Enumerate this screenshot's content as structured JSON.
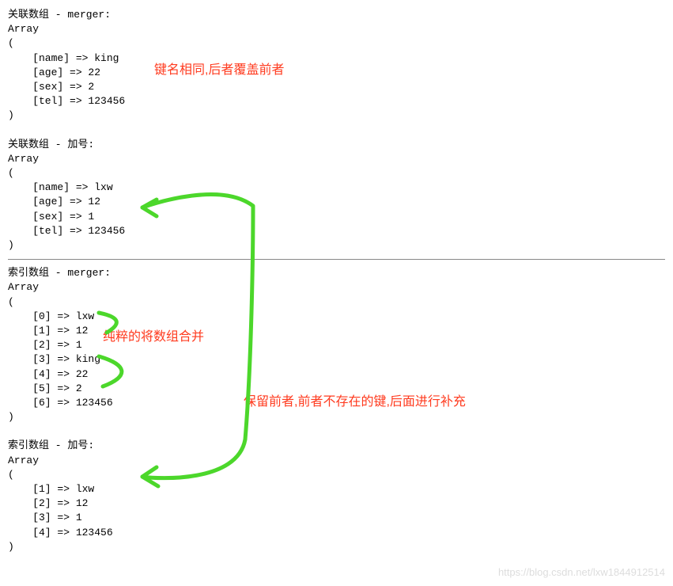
{
  "block1": {
    "title": "关联数组 - merger:",
    "arr_label": "Array",
    "open": "(",
    "close": ")",
    "lines": [
      "    [name] => king",
      "    [age] => 22",
      "    [sex] => 2",
      "    [tel] => 123456"
    ]
  },
  "block2": {
    "title": "关联数组 - 加号:",
    "arr_label": "Array",
    "open": "(",
    "close": ")",
    "lines": [
      "    [name] => lxw",
      "    [age] => 12",
      "    [sex] => 1",
      "    [tel] => 123456"
    ]
  },
  "block3": {
    "title": "索引数组 - merger:",
    "arr_label": "Array",
    "open": "(",
    "close": ")",
    "lines": [
      "    [0] => lxw",
      "    [1] => 12",
      "    [2] => 1",
      "    [3] => king",
      "    [4] => 22",
      "    [5] => 2",
      "    [6] => 123456"
    ]
  },
  "block4": {
    "title": "索引数组 - 加号:",
    "arr_label": "Array",
    "open": "(",
    "close": ")",
    "lines": [
      "    [1] => lxw",
      "    [2] => 12",
      "    [3] => 1",
      "    [4] => 123456"
    ]
  },
  "annot": {
    "a1": "键名相同,后者覆盖前者",
    "a2": "纯粹的将数组合并",
    "a3": "保留前者,前者不存在的键,后面进行补充"
  },
  "watermark": "https://blog.csdn.net/lxw1844912514"
}
